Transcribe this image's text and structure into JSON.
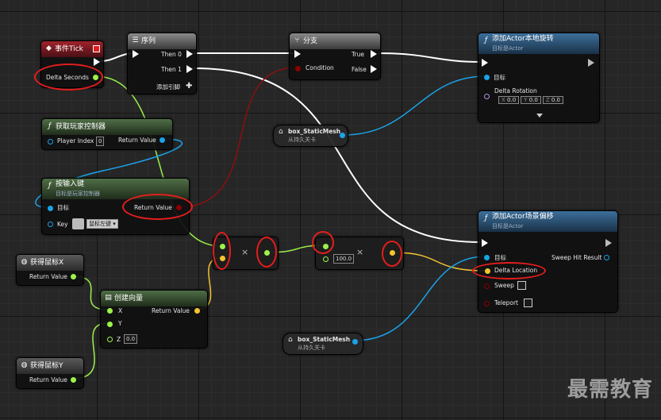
{
  "colors": {
    "exec": "#ffffff",
    "float": "#9cf24a",
    "vector": "#f4c430",
    "object": "#1aa3e8",
    "bool": "#8b0000",
    "accent": "#e51d1d"
  },
  "event_tick": {
    "title": "事件Tick",
    "delta": "Delta Seconds"
  },
  "sequence": {
    "title": "序列",
    "then0": "Then 0",
    "then1": "Then 1",
    "add_pin": "添加引脚"
  },
  "branch": {
    "title": "分支",
    "condition": "Condition",
    "true_label": "True",
    "false_label": "False"
  },
  "add_rotation": {
    "title": "添加Actor本地旋转",
    "subtitle": "目标是Actor",
    "target": "目标",
    "delta_rotation": "Delta Rotation",
    "x_label": "X",
    "x_val": "0.0",
    "y_label": "Y",
    "y_val": "0.0",
    "z_label": "Z",
    "z_val": "0.0"
  },
  "get_pc": {
    "title": "获取玩家控制器",
    "player_index": "Player Index",
    "player_index_val": "0",
    "return_value": "Return Value"
  },
  "mesh1": {
    "title": "box_StaticMesh",
    "subtitle": "从持久关卡"
  },
  "input_key": {
    "title": "按输入键",
    "subtitle": "目标是玩家控制器",
    "target": "目标",
    "key": "Key",
    "key_val": "鼠标左键",
    "return_value": "Return Value"
  },
  "mul1": {
    "op": "×"
  },
  "mul2": {
    "op": "×",
    "value": "100.0"
  },
  "add_offset": {
    "title": "添加Actor场景偏移",
    "subtitle": "目标是Actor",
    "target": "目标",
    "sweep_hit": "Sweep Hit Result",
    "delta_location": "Delta Location",
    "sweep": "Sweep",
    "teleport": "Teleport"
  },
  "mouse_x": {
    "title": "获得鼠标X",
    "return_value": "Return Value"
  },
  "make_vec": {
    "title": "创建向量",
    "x": "X",
    "y": "Y",
    "z": "Z",
    "z_val": "0.0",
    "return_value": "Return Value"
  },
  "mesh2": {
    "title": "box_StaticMesh",
    "subtitle": "从持久关卡"
  },
  "mouse_y": {
    "title": "获得鼠标Y",
    "return_value": "Return Value"
  },
  "watermark": "最需教育"
}
